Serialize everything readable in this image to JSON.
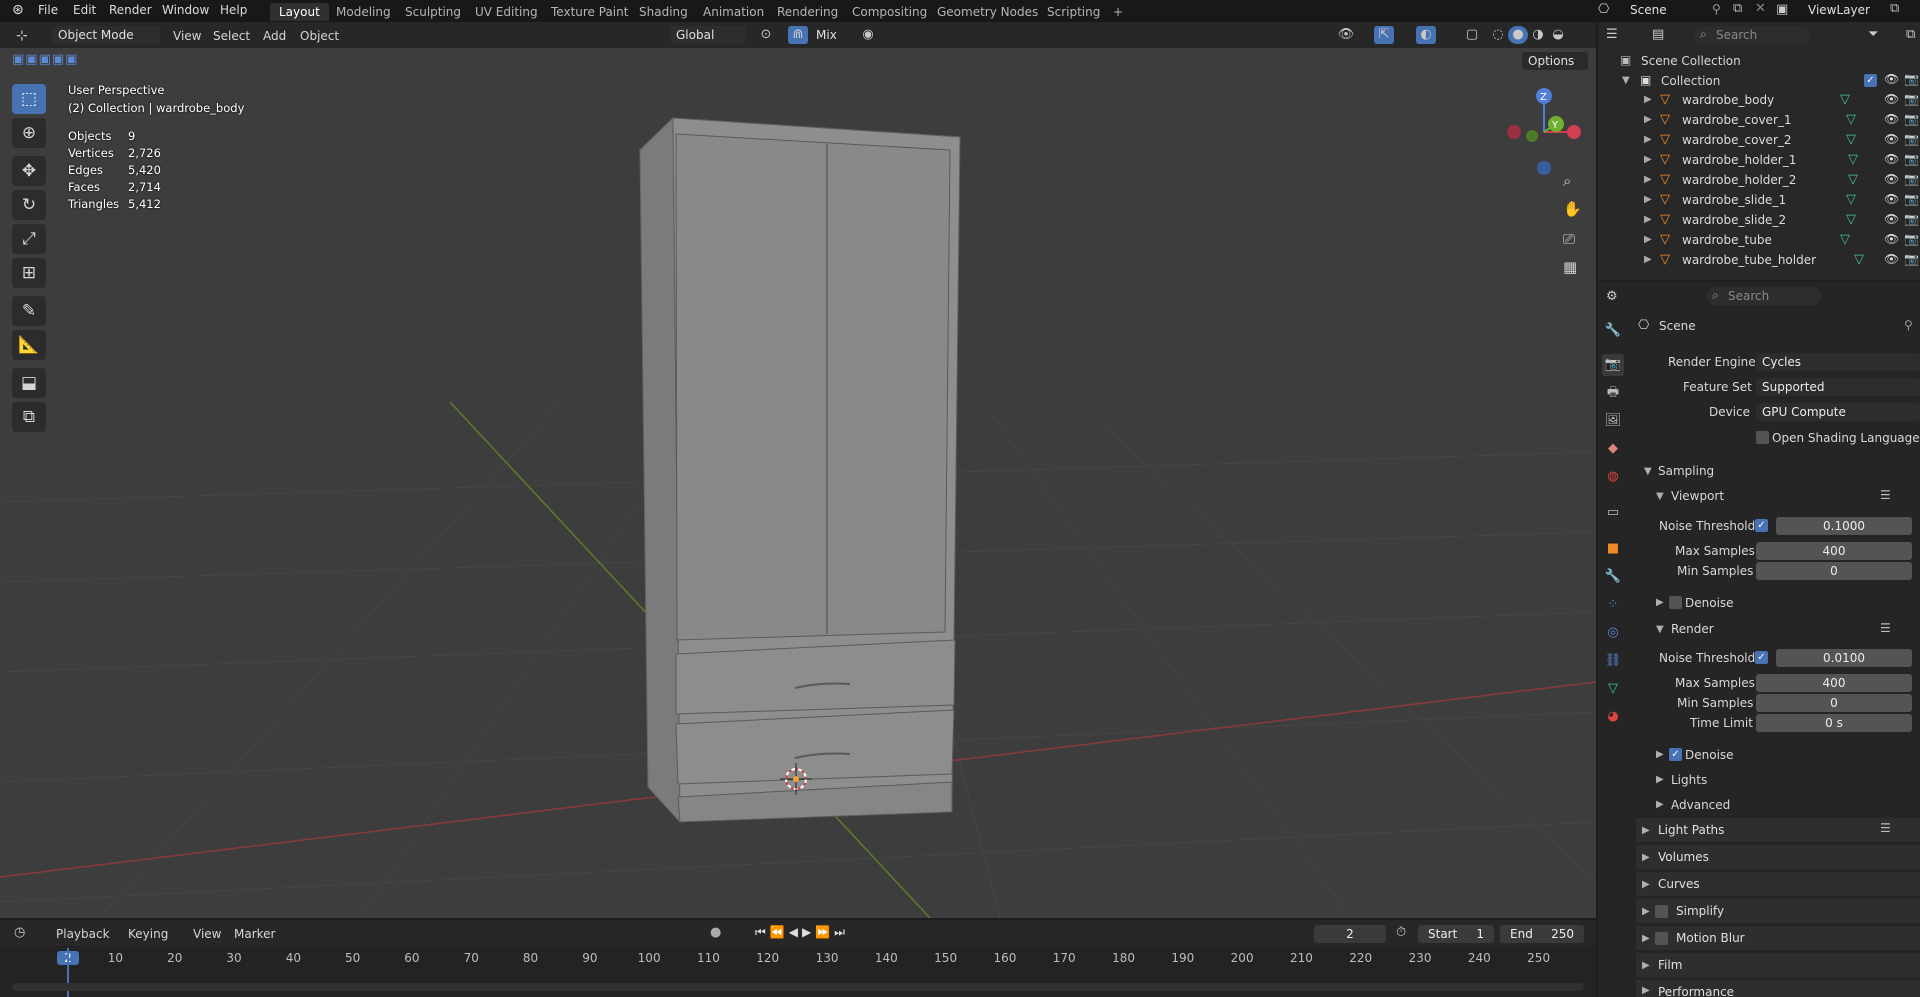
{
  "menu": [
    "File",
    "Edit",
    "Render",
    "Window",
    "Help"
  ],
  "workspaces": [
    {
      "label": "Layout",
      "active": true
    },
    {
      "label": "Modeling"
    },
    {
      "label": "Sculpting"
    },
    {
      "label": "UV Editing"
    },
    {
      "label": "Texture Paint"
    },
    {
      "label": "Shading"
    },
    {
      "label": "Animation"
    },
    {
      "label": "Rendering"
    },
    {
      "label": "Compositing"
    },
    {
      "label": "Geometry Nodes"
    },
    {
      "label": "Scripting"
    }
  ],
  "add_workspace": "+",
  "scene_name": "Scene",
  "view_layer": "ViewLayer",
  "viewport_header": {
    "mode": "Object Mode",
    "menus": [
      "View",
      "Select",
      "Add",
      "Object"
    ],
    "orientation": "Global",
    "snap_mode": "Mix",
    "options": "Options"
  },
  "overlay": {
    "view_name": "User Perspective",
    "collection_line": "(2) Collection | wardrobe_body",
    "stats": [
      {
        "label": "Objects",
        "value": "9"
      },
      {
        "label": "Vertices",
        "value": "2,726"
      },
      {
        "label": "Edges",
        "value": "5,420"
      },
      {
        "label": "Faces",
        "value": "2,714"
      },
      {
        "label": "Triangles",
        "value": "5,412"
      }
    ]
  },
  "gizmo": {
    "z": "Z",
    "y": "Y"
  },
  "outliner": {
    "search_placeholder": "Search",
    "root": "Scene Collection",
    "collection": "Collection",
    "objects": [
      "wardrobe_body",
      "wardrobe_cover_1",
      "wardrobe_cover_2",
      "wardrobe_holder_1",
      "wardrobe_holder_2",
      "wardrobe_slide_1",
      "wardrobe_slide_2",
      "wardrobe_tube",
      "wardrobe_tube_holder"
    ]
  },
  "properties": {
    "search_placeholder": "Search",
    "context": "Scene",
    "render_engine_label": "Render Engine",
    "render_engine": "Cycles",
    "feature_set_label": "Feature Set",
    "feature_set": "Supported",
    "device_label": "Device",
    "device": "GPU Compute",
    "osl_label": "Open Shading Language",
    "sampling": "Sampling",
    "viewport": "Viewport",
    "vp_noise_label": "Noise Threshold",
    "vp_noise": "0.1000",
    "vp_max_label": "Max Samples",
    "vp_max": "400",
    "vp_min_label": "Min Samples",
    "vp_min": "0",
    "vp_denoise": "Denoise",
    "render": "Render",
    "r_noise_label": "Noise Threshold",
    "r_noise": "0.0100",
    "r_max_label": "Max Samples",
    "r_max": "400",
    "r_min_label": "Min Samples",
    "r_min": "0",
    "r_time_label": "Time Limit",
    "r_time": "0 s",
    "r_denoise": "Denoise",
    "lights": "Lights",
    "advanced": "Advanced",
    "light_paths": "Light Paths",
    "volumes": "Volumes",
    "curves": "Curves",
    "simplify": "Simplify",
    "motion_blur": "Motion Blur",
    "film": "Film",
    "performance": "Performance"
  },
  "timeline": {
    "menus": [
      "Playback",
      "Keying",
      "View",
      "Marker"
    ],
    "current_frame": "2",
    "start_label": "Start",
    "start": "1",
    "end_label": "End",
    "end": "250",
    "ticks": [
      "2",
      "10",
      "20",
      "30",
      "40",
      "50",
      "60",
      "70",
      "80",
      "90",
      "100",
      "110",
      "120",
      "130",
      "140",
      "150",
      "160",
      "170",
      "180",
      "190",
      "200",
      "210",
      "220",
      "230",
      "240",
      "250"
    ]
  }
}
